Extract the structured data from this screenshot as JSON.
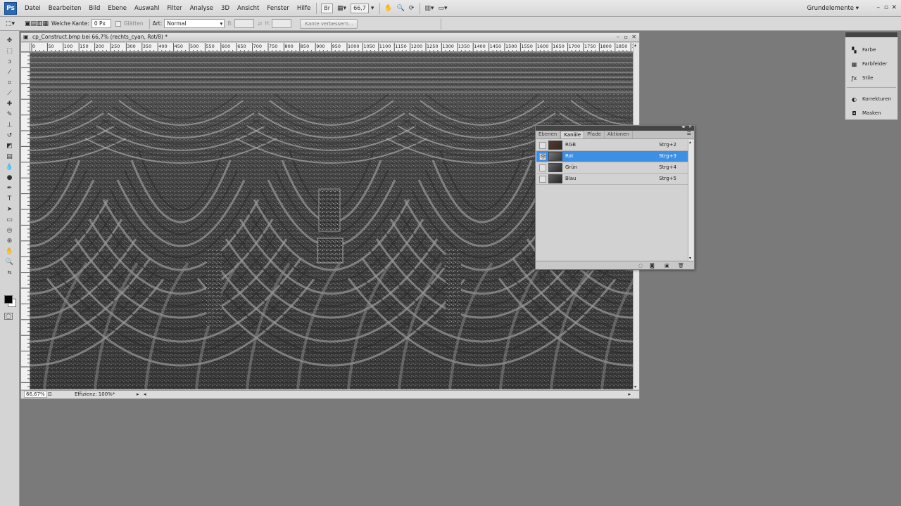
{
  "menubar": {
    "logo": "Ps",
    "items": [
      "Datei",
      "Bearbeiten",
      "Bild",
      "Ebene",
      "Auswahl",
      "Filter",
      "Analyse",
      "3D",
      "Ansicht",
      "Fenster",
      "Hilfe"
    ],
    "zoom": "66,7",
    "workspace": "Grundelemente"
  },
  "options": {
    "soft_edge_label": "Weiche Kante:",
    "soft_edge_value": "0 Px",
    "smooth_label": "Glätten",
    "style_label": "Art:",
    "style_value": "Normal",
    "width_label": "B:",
    "height_label": "H:",
    "refine_button": "Kante verbessern..."
  },
  "document": {
    "title": "cp_Construct.bmp bei 66,7% (rechts_cyan, Rot/8) *",
    "ruler_top": [
      "0",
      "50",
      "100",
      "150",
      "200",
      "250",
      "300",
      "350",
      "400",
      "450",
      "500",
      "550",
      "600",
      "650",
      "700",
      "750",
      "800",
      "850",
      "900",
      "950",
      "1000",
      "1050",
      "1100",
      "1150",
      "1200",
      "1250",
      "1300",
      "1350",
      "1400",
      "1450",
      "1500",
      "1550",
      "1600",
      "1650",
      "1700",
      "1750",
      "1800",
      "1850",
      "1900"
    ],
    "zoom_status": "66,67%",
    "status_text": "Effizienz: 100%*"
  },
  "channels_panel": {
    "tabs": [
      "Ebenen",
      "Kanäle",
      "Pfade",
      "Aktionen"
    ],
    "active_tab": "Kanäle",
    "channels": [
      {
        "name": "RGB",
        "shortcut": "Strg+2",
        "visible": false,
        "selected": false
      },
      {
        "name": "Rot",
        "shortcut": "Strg+3",
        "visible": true,
        "selected": true
      },
      {
        "name": "Grün",
        "shortcut": "Strg+4",
        "visible": false,
        "selected": false
      },
      {
        "name": "Blau",
        "shortcut": "Strg+5",
        "visible": false,
        "selected": false
      }
    ]
  },
  "right_dock": {
    "items": [
      {
        "label": "Farbe",
        "icon": "color-icon"
      },
      {
        "label": "Farbfelder",
        "icon": "swatches-icon"
      },
      {
        "label": "Stile",
        "icon": "styles-icon"
      },
      {
        "label": "Korrekturen",
        "icon": "adjustments-icon"
      },
      {
        "label": "Masken",
        "icon": "masks-icon"
      }
    ]
  },
  "colors": {
    "selected_row": "#3b8fe4",
    "workspace_bg": "#7a7a7a",
    "foreground": "#000000",
    "background": "#ffffff"
  }
}
